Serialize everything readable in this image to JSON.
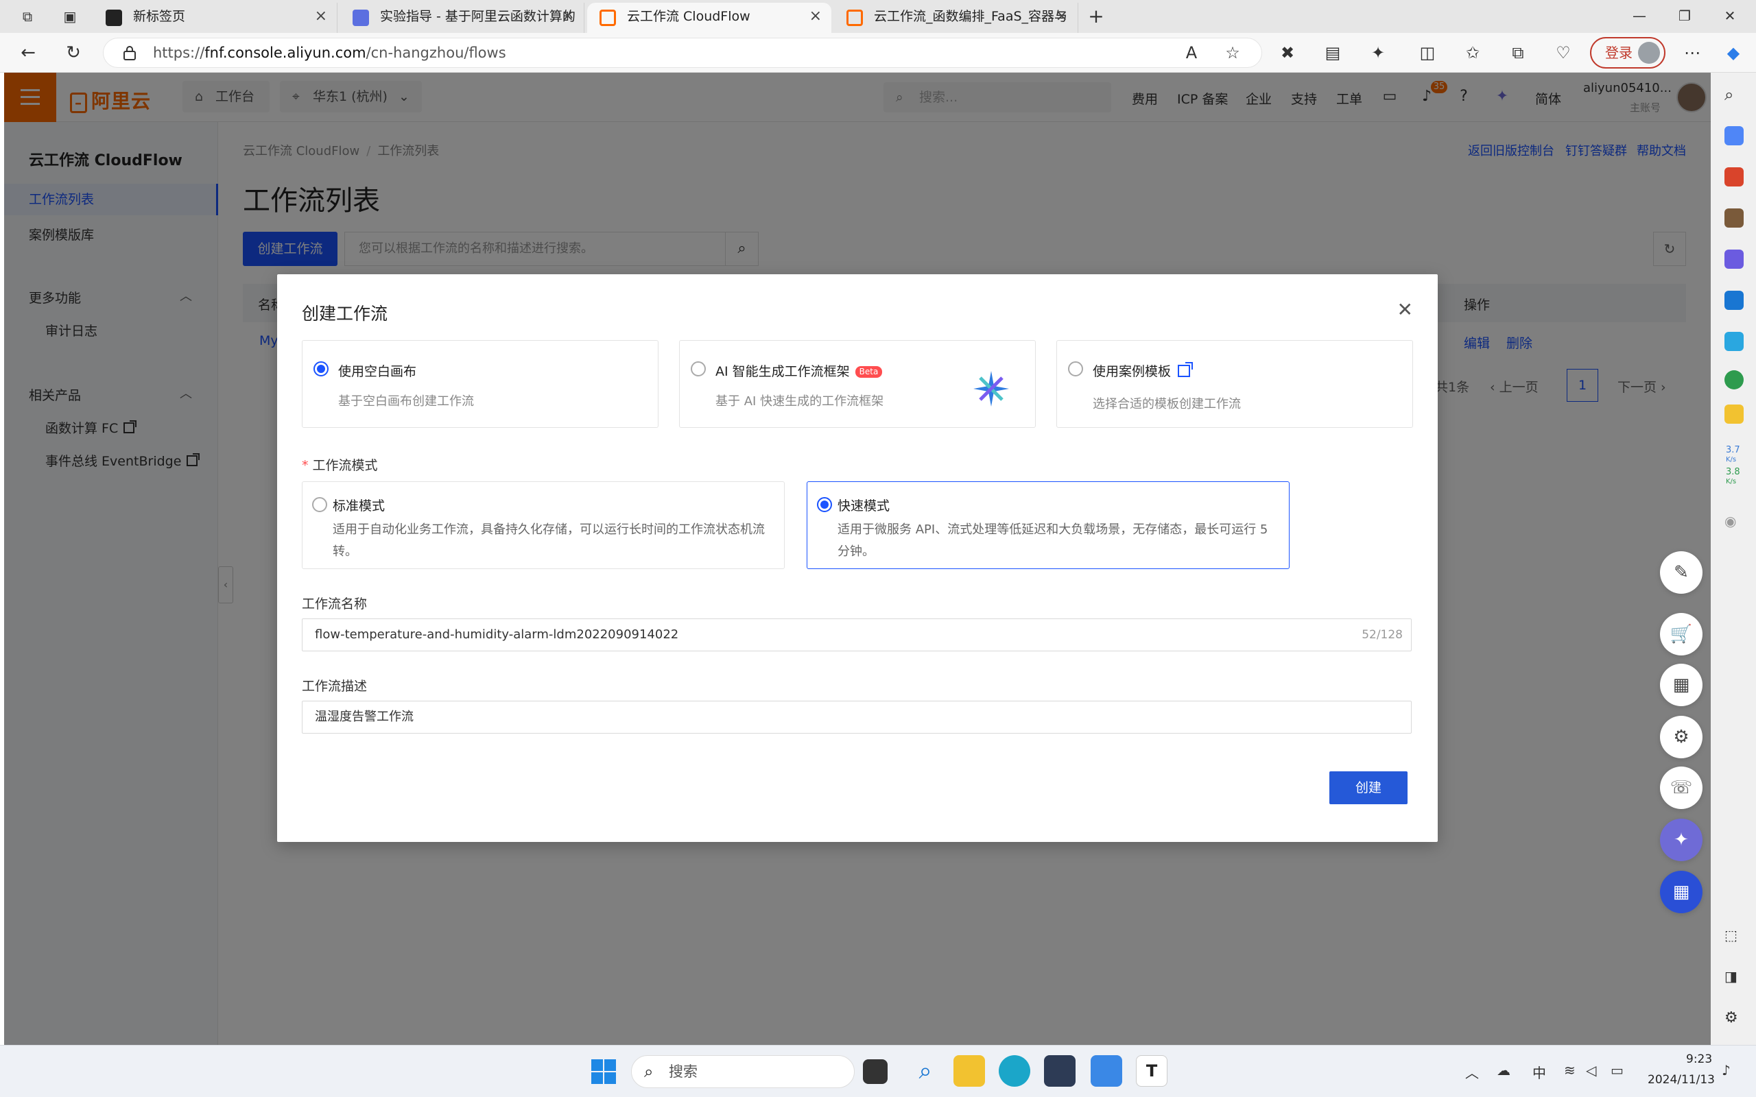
{
  "browser": {
    "tabs": [
      {
        "title": "新标签页"
      },
      {
        "title": "实验指导 - 基于阿里云函数计算的"
      },
      {
        "title": "云工作流 CloudFlow"
      },
      {
        "title": "云工作流_函数编排_FaaS_容器与"
      }
    ],
    "url": "https://fnf.console.aliyun.com/cn-hangzhou/flows",
    "url_host": "fnf.console.aliyun.com",
    "url_prefix": "https://",
    "url_path": "/cn-hangzhou/flows",
    "login_label": "登录"
  },
  "console_header": {
    "brand": "阿里云",
    "workbench": "工作台",
    "region": "华东1 (杭州)",
    "search_placeholder": "搜索...",
    "links": [
      "费用",
      "ICP 备案",
      "企业",
      "支持",
      "工单"
    ],
    "notification_count": "35",
    "language": "简体",
    "account_name": "aliyun05410...",
    "account_sub": "主账号"
  },
  "sidebar": {
    "title": "云工作流 CloudFlow",
    "items": [
      {
        "label": "工作流列表",
        "active": true
      },
      {
        "label": "案例模版库",
        "active": false
      }
    ],
    "more_group": "更多功能",
    "more_items": [
      {
        "label": "审计日志"
      }
    ],
    "related_group": "相关产品",
    "related_items": [
      {
        "label": "函数计算 FC"
      },
      {
        "label": "事件总线 EventBridge"
      }
    ]
  },
  "main": {
    "breadcrumb": [
      "云工作流 CloudFlow",
      "工作流列表"
    ],
    "top_links": [
      "返回旧版控制台",
      "钉钉答疑群",
      "帮助文档"
    ],
    "page_title": "工作流列表",
    "create_button": "创建工作流",
    "search_placeholder": "您可以根据工作流的名称和描述进行搜索。",
    "table_headers": {
      "name": "名称",
      "actions": "操作"
    },
    "row": {
      "name": "My",
      "edit": "编辑",
      "delete": "删除"
    },
    "pager": {
      "total": "共1条",
      "prev": "上一页",
      "page": "1",
      "next": "下一页"
    }
  },
  "modal": {
    "title": "创建工作流",
    "source_options": [
      {
        "title": "使用空白画布",
        "desc": "基于空白画布创建工作流",
        "selected": true
      },
      {
        "title": "AI 智能生成工作流框架",
        "badge": "Beta",
        "desc": "基于 AI 快速生成的工作流框架",
        "selected": false
      },
      {
        "title": "使用案例模板",
        "desc": "选择合适的模板创建工作流",
        "selected": false
      }
    ],
    "mode_label": "工作流模式",
    "modes": [
      {
        "title": "标准模式",
        "desc": "适用于自动化业务工作流，具备持久化存储，可以运行长时间的工作流状态机流转。",
        "selected": false
      },
      {
        "title": "快速模式",
        "desc": "适用于微服务 API、流式处理等低延迟和大负载场景，无存储态，最长可运行 5 分钟。",
        "selected": true
      }
    ],
    "name_label": "工作流名称",
    "name_value": "flow-temperature-and-humidity-alarm-ldm2022090914022",
    "name_count": "52/128",
    "desc_label": "工作流描述",
    "desc_value": "温湿度告警工作流",
    "create_button": "创建"
  },
  "edge_sidebar": {
    "net_up": "3.7",
    "net_down": "3.8",
    "net_unit": "K/s"
  },
  "taskbar": {
    "search_label": "搜索",
    "ime": "中",
    "time": "9:23",
    "date": "2024/11/13"
  }
}
